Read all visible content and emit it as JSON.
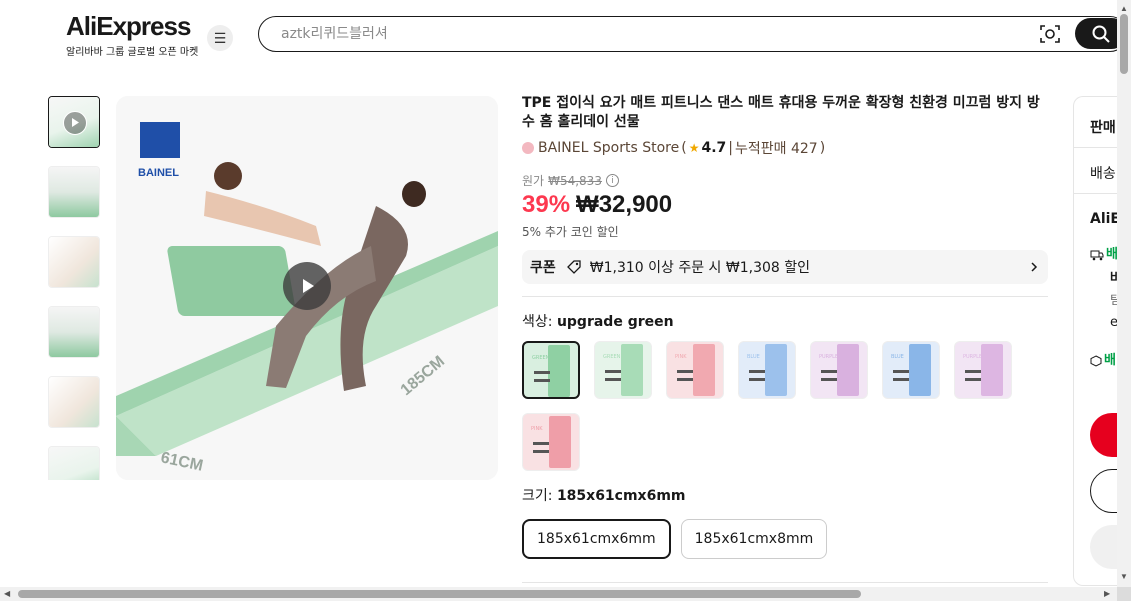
{
  "header": {
    "logo_text": "AliExpress",
    "logo_subtitle": "알리바바 그룹 글로벌 오픈 마켓",
    "menu_icon": "hamburger-menu-icon",
    "search_placeholder": "aztk리퀴드블러셔",
    "camera_icon": "image-search-icon",
    "search_icon": "search-icon"
  },
  "gallery": {
    "thumbnails": [
      "video",
      "image",
      "image",
      "image",
      "image",
      "image"
    ],
    "size_labels": [
      "185CM",
      "61CM"
    ],
    "brand_logo_text": "BAINEL"
  },
  "product": {
    "title": "TPE 접이식 요가 매트 피트니스 댄스 매트 휴대용 두꺼운 확장형 친환경 미끄럼 방지 방수 홈 홀리데이 선물",
    "store_name": "BAINEL Sports Store",
    "store_paren_open": "(",
    "rating": "4.7",
    "separator": "|",
    "sold_label": "누적판매 427",
    "store_paren_close": ")",
    "original_label": "원가",
    "original_price": "₩54,833",
    "discount": "39%",
    "price": "₩32,900",
    "coin_text": "5% 추가 코인 할인",
    "coupon": {
      "label": "쿠폰",
      "text": "₩1,310 이상 주문 시 ₩1,308 할인"
    },
    "color": {
      "label": "색상:",
      "selected": "upgrade green",
      "swatches": [
        {
          "name": "upgrade green",
          "text": "GREEN",
          "bg": "#d9efe0",
          "mat": "#8fd0a3"
        },
        {
          "name": "green",
          "text": "GREEN",
          "bg": "#e6f4ea",
          "mat": "#a8dcb7"
        },
        {
          "name": "pink",
          "text": "PINK",
          "bg": "#f9e1e3",
          "mat": "#f1a9b0"
        },
        {
          "name": "blue",
          "text": "BLUE",
          "bg": "#e2ecf9",
          "mat": "#9cc1ec"
        },
        {
          "name": "purple",
          "text": "PURPLE",
          "bg": "#f2e5f4",
          "mat": "#d9b1df"
        },
        {
          "name": "blue 2",
          "text": "BLUE",
          "bg": "#e2ecf9",
          "mat": "#8ab6e8"
        },
        {
          "name": "purple 2",
          "text": "PURPLE",
          "bg": "#f2e5f4",
          "mat": "#ddb6e2"
        },
        {
          "name": "pink 2",
          "text": "PINK",
          "bg": "#f9e1e3",
          "mat": "#ef9ea8"
        }
      ]
    },
    "size": {
      "label": "크기:",
      "selected": "185x61cmx6mm",
      "options": [
        "185x61cmx6mm",
        "185x61cmx8mm"
      ]
    }
  },
  "side_panel": {
    "title": "판매",
    "shipping": "배송",
    "ali": "AliE",
    "ship_line1": "배",
    "ship_line2": "바",
    "ship_line3": "팀",
    "ship_line4": "e",
    "return_line": "배"
  },
  "colors": {
    "accent_red": "#fd384f",
    "buy_red": "#e6001e",
    "text": "#191919"
  }
}
